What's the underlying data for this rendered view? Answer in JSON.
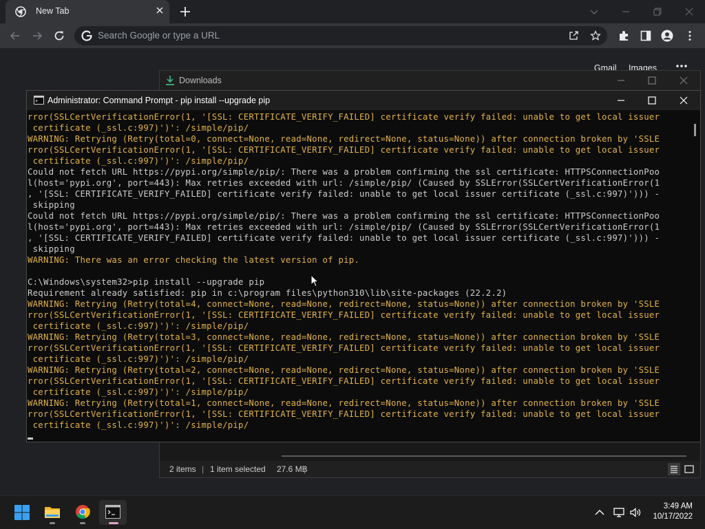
{
  "chrome": {
    "tab_title": "New Tab",
    "search_placeholder": "Search Google or type a URL",
    "links": [
      "Gmail",
      "Images"
    ]
  },
  "explorer": {
    "title": "Downloads",
    "status_items": "2 items",
    "status_selected": "1 item selected",
    "status_size": "27.6 MB"
  },
  "cmd": {
    "title": "Administrator: Command Prompt - pip  install --upgrade pip",
    "lines": [
      {
        "t": "w",
        "text": "rror(SSLCertVerificationError(1, '[SSL: CERTIFICATE_VERIFY_FAILED] certificate verify failed: unable to get local issuer"
      },
      {
        "t": "w",
        "text": " certificate (_ssl.c:997)')': /simple/pip/"
      },
      {
        "t": "w",
        "text": "WARNING: Retrying (Retry(total=0, connect=None, read=None, redirect=None, status=None)) after connection broken by 'SSLE"
      },
      {
        "t": "w",
        "text": "rror(SSLCertVerificationError(1, '[SSL: CERTIFICATE_VERIFY_FAILED] certificate verify failed: unable to get local issuer"
      },
      {
        "t": "w",
        "text": " certificate (_ssl.c:997)')': /simple/pip/"
      },
      {
        "t": "n",
        "text": "Could not fetch URL https://pypi.org/simple/pip/: There was a problem confirming the ssl certificate: HTTPSConnectionPoo"
      },
      {
        "t": "n",
        "text": "l(host='pypi.org', port=443): Max retries exceeded with url: /simple/pip/ (Caused by SSLError(SSLCertVerificationError(1"
      },
      {
        "t": "n",
        "text": ", '[SSL: CERTIFICATE_VERIFY_FAILED] certificate verify failed: unable to get local issuer certificate (_ssl.c:997)'))) -"
      },
      {
        "t": "n",
        "text": " skipping"
      },
      {
        "t": "n",
        "text": "Could not fetch URL https://pypi.org/simple/pip/: There was a problem confirming the ssl certificate: HTTPSConnectionPoo"
      },
      {
        "t": "n",
        "text": "l(host='pypi.org', port=443): Max retries exceeded with url: /simple/pip/ (Caused by SSLError(SSLCertVerificationError(1"
      },
      {
        "t": "n",
        "text": ", '[SSL: CERTIFICATE_VERIFY_FAILED] certificate verify failed: unable to get local issuer certificate (_ssl.c:997)'))) -"
      },
      {
        "t": "n",
        "text": " skipping"
      },
      {
        "t": "w",
        "text": "WARNING: There was an error checking the latest version of pip."
      },
      {
        "t": "n",
        "text": ""
      },
      {
        "t": "n",
        "text": "C:\\Windows\\system32>pip install --upgrade pip"
      },
      {
        "t": "n",
        "text": "Requirement already satisfied: pip in c:\\program files\\python310\\lib\\site-packages (22.2.2)"
      },
      {
        "t": "w",
        "text": "WARNING: Retrying (Retry(total=4, connect=None, read=None, redirect=None, status=None)) after connection broken by 'SSLE"
      },
      {
        "t": "w",
        "text": "rror(SSLCertVerificationError(1, '[SSL: CERTIFICATE_VERIFY_FAILED] certificate verify failed: unable to get local issuer"
      },
      {
        "t": "w",
        "text": " certificate (_ssl.c:997)')': /simple/pip/"
      },
      {
        "t": "w",
        "text": "WARNING: Retrying (Retry(total=3, connect=None, read=None, redirect=None, status=None)) after connection broken by 'SSLE"
      },
      {
        "t": "w",
        "text": "rror(SSLCertVerificationError(1, '[SSL: CERTIFICATE_VERIFY_FAILED] certificate verify failed: unable to get local issuer"
      },
      {
        "t": "w",
        "text": " certificate (_ssl.c:997)')': /simple/pip/"
      },
      {
        "t": "w",
        "text": "WARNING: Retrying (Retry(total=2, connect=None, read=None, redirect=None, status=None)) after connection broken by 'SSLE"
      },
      {
        "t": "w",
        "text": "rror(SSLCertVerificationError(1, '[SSL: CERTIFICATE_VERIFY_FAILED] certificate verify failed: unable to get local issuer"
      },
      {
        "t": "w",
        "text": " certificate (_ssl.c:997)')': /simple/pip/"
      },
      {
        "t": "w",
        "text": "WARNING: Retrying (Retry(total=1, connect=None, read=None, redirect=None, status=None)) after connection broken by 'SSLE"
      },
      {
        "t": "w",
        "text": "rror(SSLCertVerificationError(1, '[SSL: CERTIFICATE_VERIFY_FAILED] certificate verify failed: unable to get local issuer"
      },
      {
        "t": "w",
        "text": " certificate (_ssl.c:997)')': /simple/pip/"
      }
    ],
    "colors": {
      "warning": "#e2b24a",
      "normal": "#cccccc",
      "background": "#0c0c0c"
    }
  },
  "taskbar": {
    "apps": [
      "start-icon",
      "file-explorer-icon",
      "chrome-icon",
      "terminal-icon"
    ],
    "time": "3:49 AM",
    "date": "10/17/2022"
  }
}
